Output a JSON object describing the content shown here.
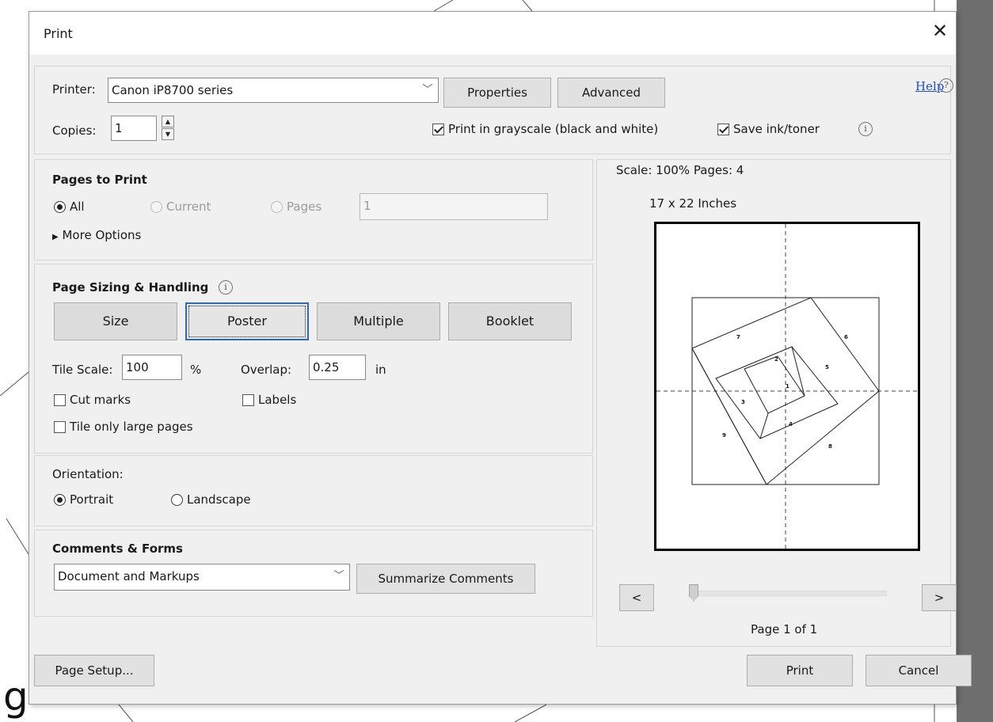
{
  "dialog": {
    "title": "Print"
  },
  "printer": {
    "label": "Printer:",
    "selected": "Canon iP8700 series",
    "properties_label": "Properties",
    "advanced_label": "Advanced",
    "help_label": "Help"
  },
  "copies": {
    "label": "Copies:",
    "value": "1"
  },
  "options": {
    "grayscale_label": "Print in grayscale (black and white)",
    "grayscale_checked": true,
    "save_ink_label": "Save ink/toner",
    "save_ink_checked": true
  },
  "pages_to_print": {
    "heading": "Pages to Print",
    "all_label": "All",
    "current_label": "Current",
    "pages_label": "Pages",
    "pages_value": "1",
    "more_options_label": "More Options"
  },
  "page_sizing": {
    "heading": "Page Sizing & Handling",
    "size_label": "Size",
    "poster_label": "Poster",
    "multiple_label": "Multiple",
    "booklet_label": "Booklet",
    "tile_scale_label": "Tile Scale:",
    "tile_scale_value": "100",
    "tile_scale_unit": "%",
    "overlap_label": "Overlap:",
    "overlap_value": "0.25",
    "overlap_unit": "in",
    "cut_marks_label": "Cut marks",
    "labels_label": "Labels",
    "tile_only_large_label": "Tile only large pages"
  },
  "orientation": {
    "heading": "Orientation:",
    "portrait_label": "Portrait",
    "landscape_label": "Landscape",
    "selected": "Portrait"
  },
  "comments_forms": {
    "heading": "Comments & Forms",
    "selected": "Document and Markups",
    "summarize_label": "Summarize Comments"
  },
  "preview": {
    "scale_text": "Scale: 100% Pages: 4",
    "size_text": "17 x 22 Inches",
    "page_numbers": [
      "1",
      "2",
      "3",
      "4",
      "5",
      "6",
      "7",
      "8",
      "9"
    ],
    "prev_label": "<",
    "next_label": ">",
    "page_indicator": "Page 1 of 1"
  },
  "footer": {
    "page_setup_label": "Page Setup...",
    "print_label": "Print",
    "cancel_label": "Cancel"
  },
  "background": {
    "partial_glyph": "g"
  }
}
